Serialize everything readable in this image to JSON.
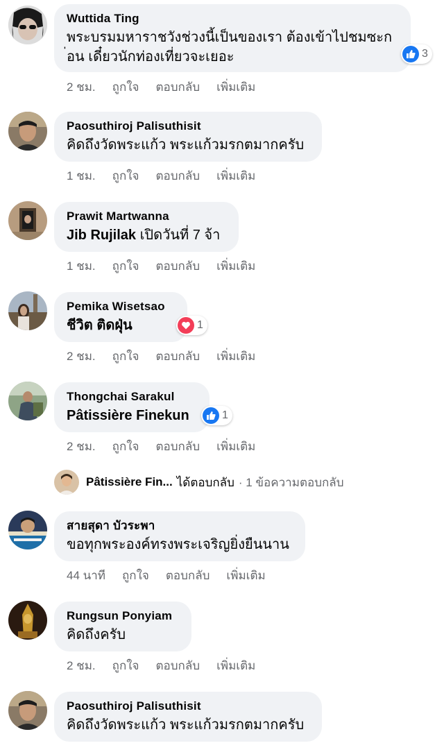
{
  "actions": {
    "like": "ถูกใจ",
    "reply": "ตอบกลับ",
    "more": "เพิ่มเติม"
  },
  "comments": [
    {
      "author": "Wuttida Ting",
      "text": "พระบรมมหาราชวังช่วงนี้เป็นของเรา ต้องเข้าไปชมซะก",
      "text2": "่อน เดี๋ยวนักท่องเที่ยวจะเยอะ",
      "time": "2 ชม.",
      "reaction": {
        "type": "like-icon",
        "count": "3"
      }
    },
    {
      "author": "Paosuthiroj Palisuthisit",
      "text": "คิดถึงวัดพระแก้ว พระแก้วมรกตมากครับ",
      "time": "1 ชม."
    },
    {
      "author": "Prawit Martwanna",
      "mention": "Jib Rujilak",
      "text": " เปิดวันที่ 7 จ้า",
      "time": "1 ชม."
    },
    {
      "author": "Pemika Wisetsao",
      "text": "ชีวิต ติดฝุ่น",
      "time": "2 ชม.",
      "reaction": {
        "type": "love-icon",
        "count": "1"
      }
    },
    {
      "author": "Thongchai Sarakul",
      "mention": "Pâtissière Finekun",
      "time": "2 ชม.",
      "reaction": {
        "type": "like-icon",
        "count": "1"
      }
    },
    {
      "author": "สายสุดา บัวระพา",
      "text": "ขอทุกพระองค์ทรงพระเจริญยิ่งยืนนาน",
      "time": "44 นาที"
    },
    {
      "author": "Rungsun Ponyiam",
      "text": "คิดถึงครับ",
      "time": "2 ชม."
    },
    {
      "author": "Paosuthiroj Palisuthisit",
      "text": "คิดถึงวัดพระแก้ว พระแก้วมรกตมากครับ",
      "time": ""
    }
  ],
  "reply": {
    "name": "Pâtissière Fin...",
    "action": "ได้ตอบกลับ",
    "count": "· 1 ข้อความตอบกลับ"
  },
  "colors": {
    "bubble": "#f0f2f5",
    "meta": "#65676b",
    "like": "#1877f2",
    "love": "#f33e58"
  }
}
